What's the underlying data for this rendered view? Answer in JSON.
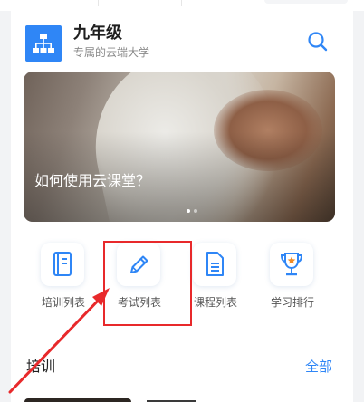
{
  "header": {
    "title": "九年级",
    "subtitle": "专属的云端大学"
  },
  "banner": {
    "caption": "如何使用云课堂？",
    "slide_count": 2,
    "active_slide": 1
  },
  "actions": [
    {
      "label": "培训列表",
      "icon": "training-book-icon"
    },
    {
      "label": "考试列表",
      "icon": "pencil-icon"
    },
    {
      "label": "课程列表",
      "icon": "document-icon"
    },
    {
      "label": "学习排行",
      "icon": "trophy-icon"
    }
  ],
  "section": {
    "title": "培训",
    "more_label": "全部"
  },
  "colors": {
    "accent": "#2f86f6",
    "highlight": "#e8292b"
  }
}
